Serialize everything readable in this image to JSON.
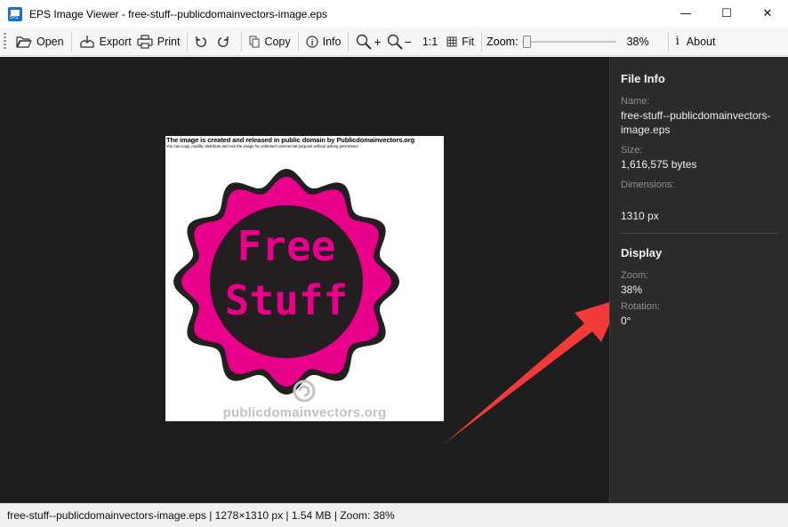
{
  "window": {
    "title": "EPS Image Viewer - free-stuff--publicdomainvectors-image.eps",
    "icon": "eps-file-icon",
    "controls": {
      "minimize": "—",
      "maximize": "☐",
      "close": "✕"
    }
  },
  "toolbar": {
    "open": "Open",
    "export": "Export",
    "print": "Print",
    "copy": "Copy",
    "info": "Info",
    "zoom_in": "+",
    "zoom_out": "−",
    "actual_size": "1:1",
    "fit": "Fit",
    "zoom_label": "Zoom:",
    "zoom_value": "38%",
    "zoom_slider_fraction": 0.0,
    "about": "About"
  },
  "image_content": {
    "line1": "The image is created and released in public domain by Publicdomainvectors.org",
    "line2": "You can copy, modify, distribute and use the image for unlimited commercial purpose without asking permission",
    "badge_word1": "Free",
    "badge_word2": "Stuff",
    "site": "publicdomainvectors.org",
    "badge_pink": "#e8008a",
    "badge_dark": "#231f20"
  },
  "side_panel": {
    "file_info_heading": "File Info",
    "name_label": "Name:",
    "name_line1": "free-stuff--publicdomainvectors-",
    "name_line2": "image.eps",
    "size_label": "Size:",
    "size_value": "1,616,575 bytes",
    "dimensions_label": "Dimensions:",
    "dimensions_value": "1310 px",
    "display_heading": "Display",
    "zoom_label": "Zoom:",
    "zoom_value": "38%",
    "rotation_label": "Rotation:",
    "rotation_value": "0°"
  },
  "annotation": {
    "arrow_color": "#f23a3a"
  },
  "statusbar": {
    "text": "free-stuff--publicdomainvectors-image.eps | 1278×1310 px | 1.54 MB | Zoom: 38%"
  }
}
